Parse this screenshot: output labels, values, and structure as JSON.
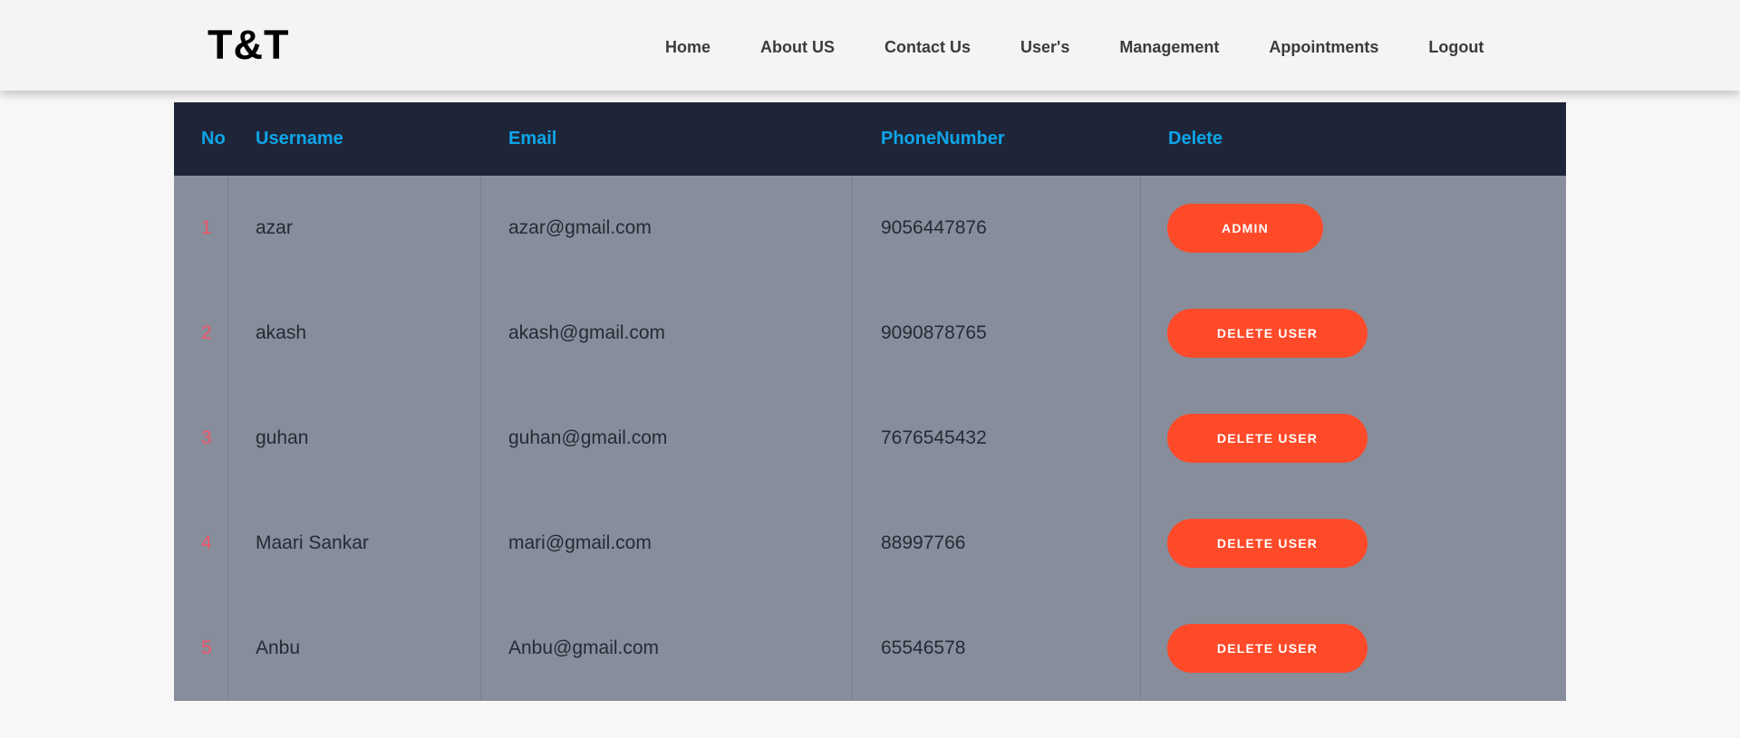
{
  "header": {
    "logo": "T&T",
    "nav": [
      "Home",
      "About US",
      "Contact Us",
      "User's",
      "Management",
      "Appointments",
      "Logout"
    ]
  },
  "table": {
    "columns": [
      "No",
      "Username",
      "Email",
      "PhoneNumber",
      "Delete"
    ],
    "rows": [
      {
        "no": "1",
        "username": "azar",
        "email": "azar@gmail.com",
        "phone": "9056447876",
        "action": "ADMIN"
      },
      {
        "no": "2",
        "username": "akash",
        "email": "akash@gmail.com",
        "phone": "9090878765",
        "action": "DELETE USER"
      },
      {
        "no": "3",
        "username": "guhan",
        "email": "guhan@gmail.com",
        "phone": "7676545432",
        "action": "DELETE USER"
      },
      {
        "no": "4",
        "username": "Maari Sankar",
        "email": "mari@gmail.com",
        "phone": "88997766",
        "action": "DELETE USER"
      },
      {
        "no": "5",
        "username": "Anbu",
        "email": "Anbu@gmail.com",
        "phone": "65546578",
        "action": "DELETE USER"
      }
    ]
  },
  "colors": {
    "header_bg": "#1f2538",
    "header_text": "#0ea5e9",
    "table_bg": "#878d9a",
    "button": "#ff4a2a",
    "row_number": "#f0546b"
  }
}
